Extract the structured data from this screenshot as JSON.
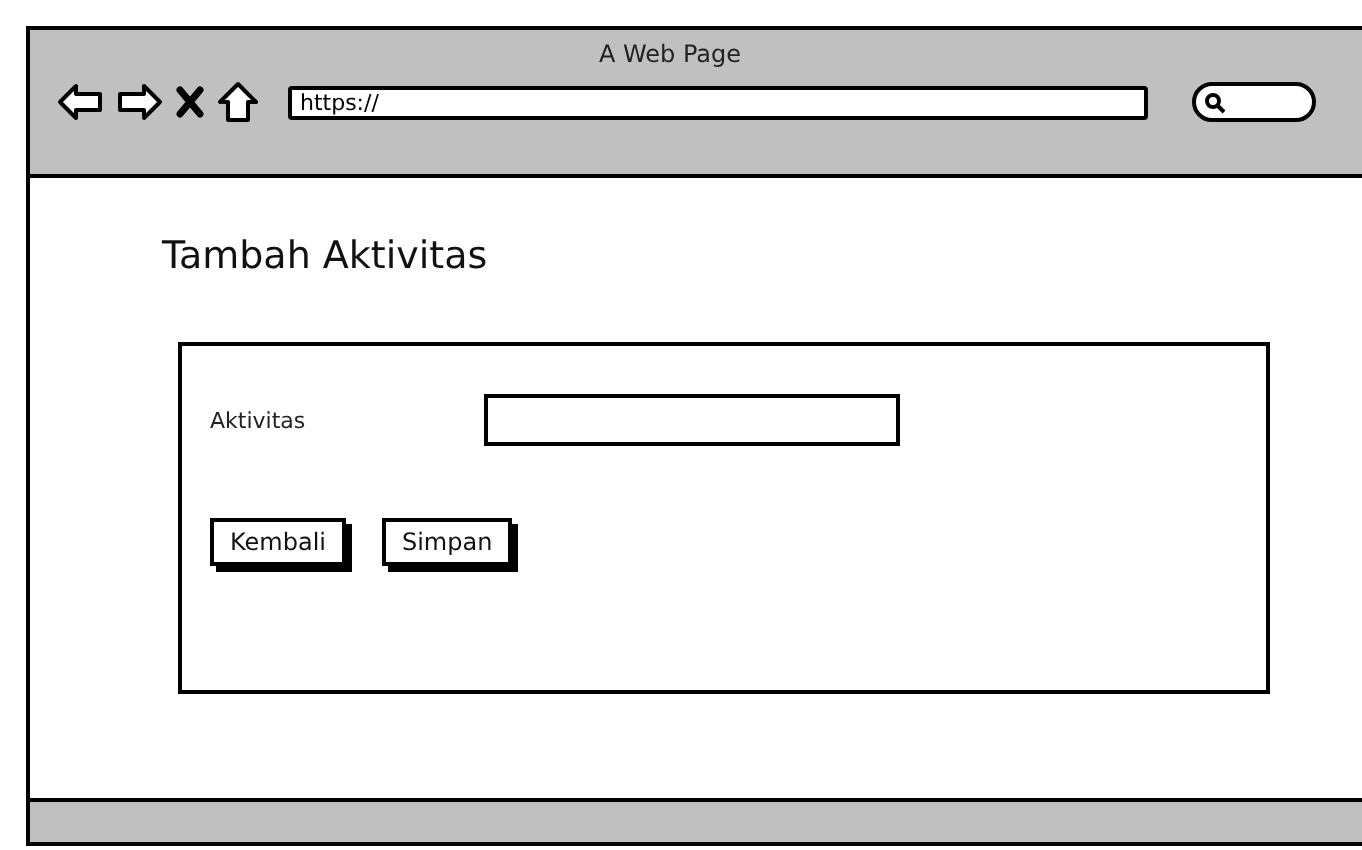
{
  "window": {
    "title": "A Web Page"
  },
  "address_bar": {
    "value": "https://"
  },
  "page": {
    "heading": "Tambah Aktivitas",
    "form": {
      "fields": [
        {
          "label": "Aktivitas"
        }
      ],
      "buttons": [
        {
          "label": "Kembali"
        },
        {
          "label": "Simpan"
        }
      ]
    }
  }
}
